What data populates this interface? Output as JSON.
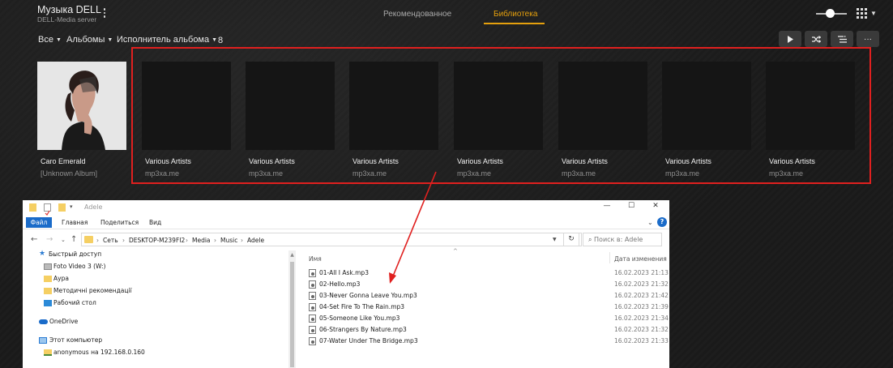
{
  "app": {
    "title": "Музыка DELL",
    "subtitle": "DELL-Media server",
    "tabs": [
      {
        "label": "Рекомендованное",
        "active": false
      },
      {
        "label": "Библиотека",
        "active": true
      }
    ],
    "accent_color": "#e5a00d",
    "zoom_slider_value": 0.35,
    "view_icon": "grid-icon"
  },
  "filters": {
    "all": "Все",
    "type": "Альбомы",
    "sort": "Исполнитель альбома",
    "count": "8"
  },
  "toolbar": {
    "buttons": [
      "play-icon",
      "shuffle-icon",
      "playlist-icon",
      "more-icon"
    ],
    "more_label": "···"
  },
  "albums": [
    {
      "title": "Caro Emerald",
      "subtitle": "[Unknown Album]",
      "has_art": true
    },
    {
      "title": "Various Artists",
      "subtitle": "mp3xa.me",
      "has_art": false
    },
    {
      "title": "Various Artists",
      "subtitle": "mp3xa.me",
      "has_art": false
    },
    {
      "title": "Various Artists",
      "subtitle": "mp3xa.me",
      "has_art": false
    },
    {
      "title": "Various Artists",
      "subtitle": "mp3xa.me",
      "has_art": false
    },
    {
      "title": "Various Artists",
      "subtitle": "mp3xa.me",
      "has_art": false
    },
    {
      "title": "Various Artists",
      "subtitle": "mp3xa.me",
      "has_art": false
    },
    {
      "title": "Various Artists",
      "subtitle": "mp3xa.me",
      "has_art": false
    }
  ],
  "highlight_color": "#e0201f",
  "explorer": {
    "title": "Adele",
    "ribbon": {
      "file": "Файл",
      "tabs": [
        "Главная",
        "Поделиться",
        "Вид"
      ]
    },
    "window_controls": {
      "minimize": "—",
      "maximize": "☐",
      "close": "✕"
    },
    "breadcrumb": [
      "Сеть",
      "DESKTOP-M239FI2",
      "Media",
      "Music",
      "Adele"
    ],
    "search_placeholder": "Поиск в: Adele",
    "nav": [
      {
        "label": "Быстрый доступ",
        "icon": "star-icon"
      },
      {
        "label": "Foto Video 3 (W:)",
        "icon": "drive-icon"
      },
      {
        "label": "Аура",
        "icon": "folder-icon"
      },
      {
        "label": "Методичні рекомендації",
        "icon": "folder-icon"
      },
      {
        "label": "Рабочий стол",
        "icon": "desktop-icon"
      },
      {
        "label": "OneDrive",
        "icon": "cloud-icon"
      },
      {
        "label": "Этот компьютер",
        "icon": "computer-icon"
      },
      {
        "label": "anonymous на 192.168.0.160",
        "icon": "network-folder-icon"
      }
    ],
    "columns": {
      "name": "Имя",
      "date": "Дата изменения"
    },
    "files": [
      {
        "name": "01-All I Ask.mp3",
        "date": "16.02.2023 21:13"
      },
      {
        "name": "02-Hello.mp3",
        "date": "16.02.2023 21:32"
      },
      {
        "name": "03-Never Gonna Leave You.mp3",
        "date": "16.02.2023 21:42"
      },
      {
        "name": "04-Set Fire To The Rain.mp3",
        "date": "16.02.2023 21:39"
      },
      {
        "name": "05-Someone Like You.mp3",
        "date": "16.02.2023 21:34"
      },
      {
        "name": "06-Strangers By Nature.mp3",
        "date": "16.02.2023 21:32"
      },
      {
        "name": "07-Water Under The Bridge.mp3",
        "date": "16.02.2023 21:33"
      }
    ]
  }
}
